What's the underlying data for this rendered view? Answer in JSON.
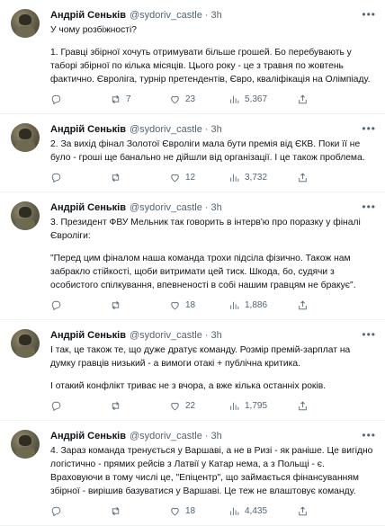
{
  "author": {
    "name": "Андрій Сеньків",
    "handle": "@sydoriv_castle",
    "separator": "·",
    "time": "3h"
  },
  "tweets": [
    {
      "paragraphs": [
        "У чому розбіжності?",
        "1. Гравці збірної хочуть отримувати більше грошей. Бо перебувають у таборі збірної по кілька місяців. Цього року - це з травня по жовтень фактично. Євроліга, турнір претендентів, Євро, кваліфікація на Олімпіаду."
      ],
      "replies": "",
      "retweets": "7",
      "likes": "23",
      "views": "5,367"
    },
    {
      "paragraphs": [
        "2. За вихід фінал Золотої Євроліги мала бути премія від ЄКВ. Поки її не було - гроші ще банально не дійшли від організації. І це також проблема."
      ],
      "replies": "",
      "retweets": "",
      "likes": "12",
      "views": "3,732"
    },
    {
      "paragraphs": [
        "3. Президент ФВУ Мельник так говорить в інтерв'ю про поразку у фіналі Євроліги:",
        "\"Перед цим фіналом наша команда трохи підсіла фізично. Також нам забракло стійкості, щоби витримати цей тиск. Шкода, бо, судячи з особистого спілкування, впевненості в собі нашим гравцям не бракує\"."
      ],
      "replies": "",
      "retweets": "",
      "likes": "18",
      "views": "1,886"
    },
    {
      "paragraphs": [
        "І так, це також те, що дуже дратує команду. Розмір премій-зарплат на думку гравців низький - а вимоги отакі + публічна критика.",
        "І отакий конфлікт триває не з вчора, а вже кілька останніх років."
      ],
      "replies": "",
      "retweets": "",
      "likes": "22",
      "views": "1,795"
    },
    {
      "paragraphs": [
        "4. Зараз команда тренується у Варшаві, а не в Ризі - як раніше. Це вигідно логістично - прямих рейсів з Латвії у Катар нема, а з Польщі - є. Враховуючи в тому числі це, \"Епіцентр\", що займається фінансуванням збірної - вирішив базуватися у Варшаві. Це теж не влаштовує команду."
      ],
      "replies": "",
      "retweets": "",
      "likes": "18",
      "views": "4,435"
    }
  ],
  "icons": {
    "more": "more-icon",
    "reply": "reply-icon",
    "retweet": "retweet-icon",
    "like": "heart-icon",
    "views": "views-icon",
    "share": "share-icon"
  },
  "colors": {
    "text": "#0f1419",
    "secondary": "#536471",
    "divider": "#eff3f4"
  }
}
